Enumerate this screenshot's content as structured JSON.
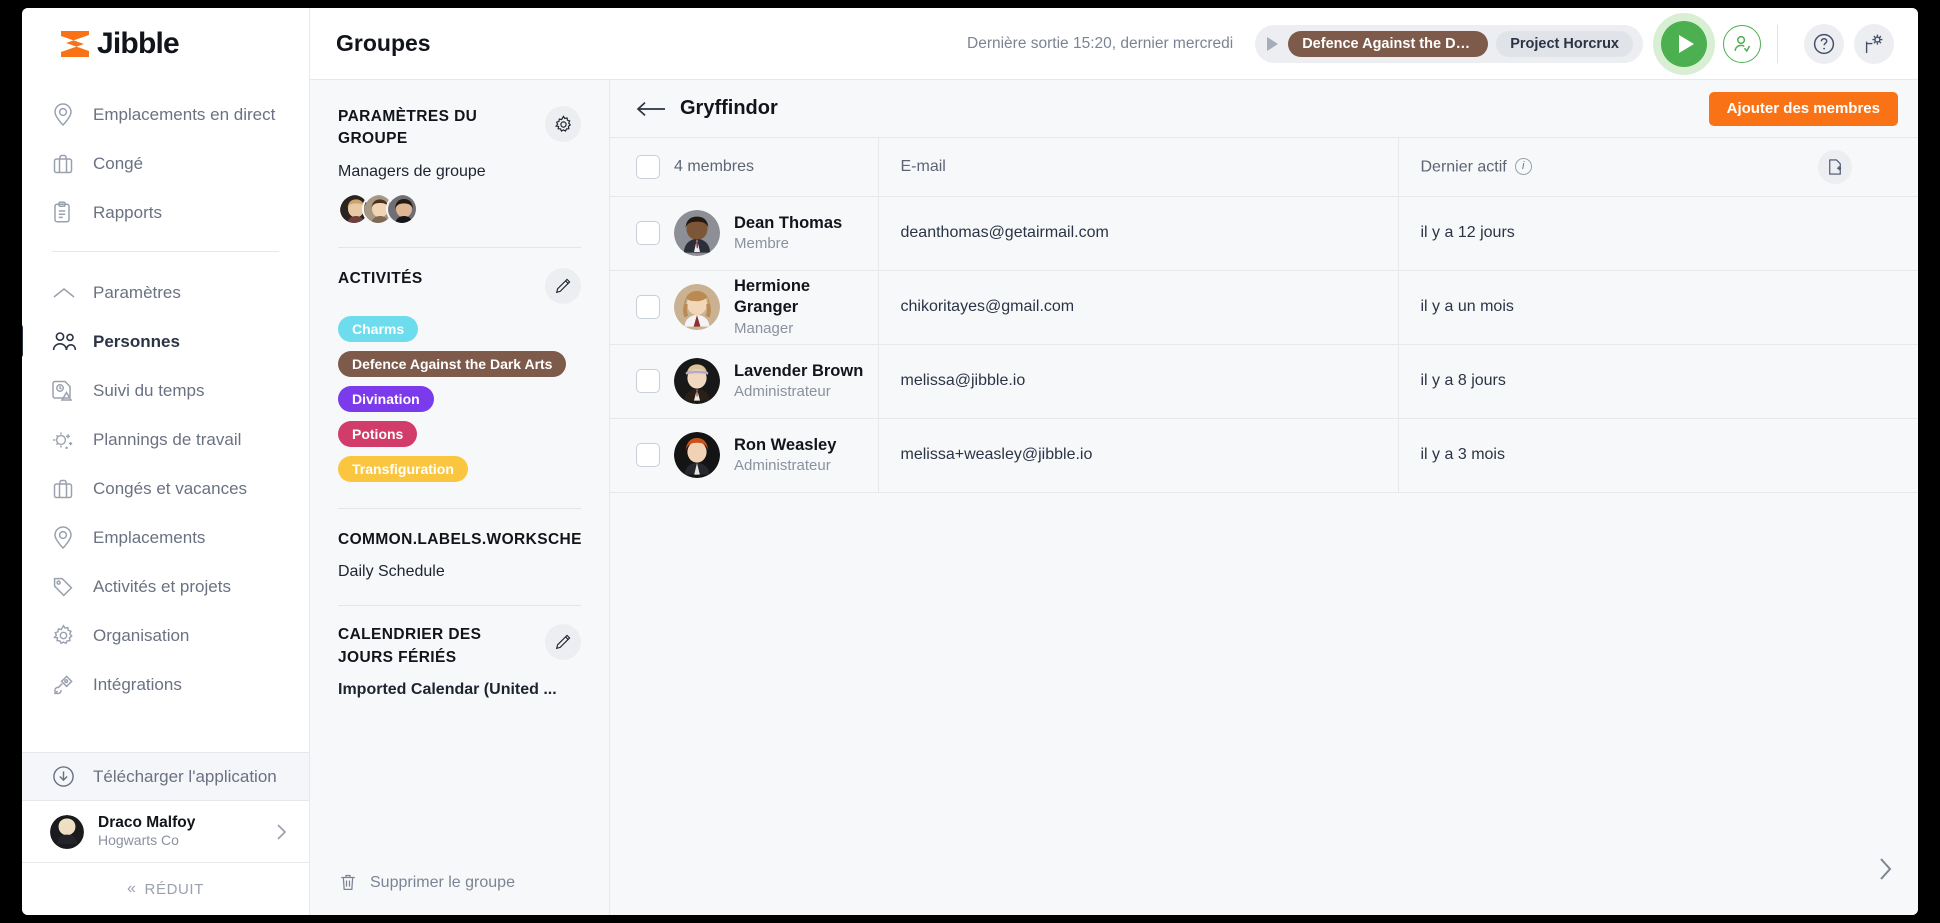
{
  "brand": {
    "name": "Jibble",
    "accent": "#f97316"
  },
  "sidebar": {
    "groups": [
      {
        "items": [
          {
            "label": "Emplacements en direct",
            "icon": "location-pin-icon"
          },
          {
            "label": "Congé",
            "icon": "briefcase-icon"
          },
          {
            "label": "Rapports",
            "icon": "clipboard-icon"
          }
        ]
      },
      {
        "items": [
          {
            "label": "Paramètres",
            "icon": "chevron-up-icon"
          },
          {
            "label": "Personnes",
            "icon": "people-icon",
            "active": true
          },
          {
            "label": "Suivi du temps",
            "icon": "time-tracking-icon"
          },
          {
            "label": "Plannings de travail",
            "icon": "schedule-icon"
          },
          {
            "label": "Congés et vacances",
            "icon": "briefcase-icon"
          },
          {
            "label": "Emplacements",
            "icon": "location-pin-icon"
          },
          {
            "label": "Activités et projets",
            "icon": "tag-icon"
          },
          {
            "label": "Organisation",
            "icon": "gear-icon"
          },
          {
            "label": "Intégrations",
            "icon": "plug-icon"
          }
        ]
      }
    ],
    "download_label": "Télécharger l'application",
    "user": {
      "name": "Draco Malfoy",
      "org": "Hogwarts Co"
    },
    "collapse_label": "RÉDUIT"
  },
  "topbar": {
    "title": "Groupes",
    "last_out": "Dernière sortie 15:20, dernier mercredi",
    "tracker": {
      "activity": "Defence Against the Da...",
      "project": "Project Horcrux"
    },
    "icons": {
      "play": "play-icon",
      "clock_in_user": "user-check-icon",
      "help": "help-icon",
      "settings": "settings-flower-icon"
    }
  },
  "settings_panel": {
    "group_settings_title": "PARAMÈTRES DU GROUPE",
    "managers_label": "Managers de groupe",
    "managers_count": 3,
    "activities_title": "ACTIVITÉS",
    "activities": [
      {
        "label": "Charms",
        "color": "#6ddced"
      },
      {
        "label": "Defence Against the Dark Arts",
        "color": "#7d5a4a"
      },
      {
        "label": "Divination",
        "color": "#7c3aed"
      },
      {
        "label": "Potions",
        "color": "#d13c6a"
      },
      {
        "label": "Transfiguration",
        "color": "#fbc63f"
      }
    ],
    "workschedule_title": "COMMON.LABELS.WORKSCHEDULE",
    "workschedule_value": "Daily Schedule",
    "holiday_title": "CALENDRIER DES JOURS FÉRIÉS",
    "holiday_value": "Imported Calendar (United ...",
    "delete_label": "Supprimer le groupe"
  },
  "members": {
    "group_name": "Gryffindor",
    "add_button": "Ajouter des membres",
    "columns": {
      "count": "4 membres",
      "email": "E-mail",
      "last_active": "Dernier actif"
    },
    "rows": [
      {
        "name": "Dean Thomas",
        "role": "Membre",
        "email": "deanthomas@getairmail.com",
        "last_active": "il y a 12 jours",
        "avatar": "#8c8f96"
      },
      {
        "name": "Hermione Granger",
        "role": "Manager",
        "email": "chikoritayes@gmail.com",
        "last_active": "il y a un mois",
        "avatar": "#c9a87a"
      },
      {
        "name": "Lavender Brown",
        "role": "Administrateur",
        "email": "melissa@jibble.io",
        "last_active": "il y a 8 jours",
        "avatar": "#5a4a3e"
      },
      {
        "name": "Ron Weasley",
        "role": "Administrateur",
        "email": "melissa+weasley@jibble.io",
        "last_active": "il y a 3 mois",
        "avatar": "#b4551f"
      }
    ]
  }
}
